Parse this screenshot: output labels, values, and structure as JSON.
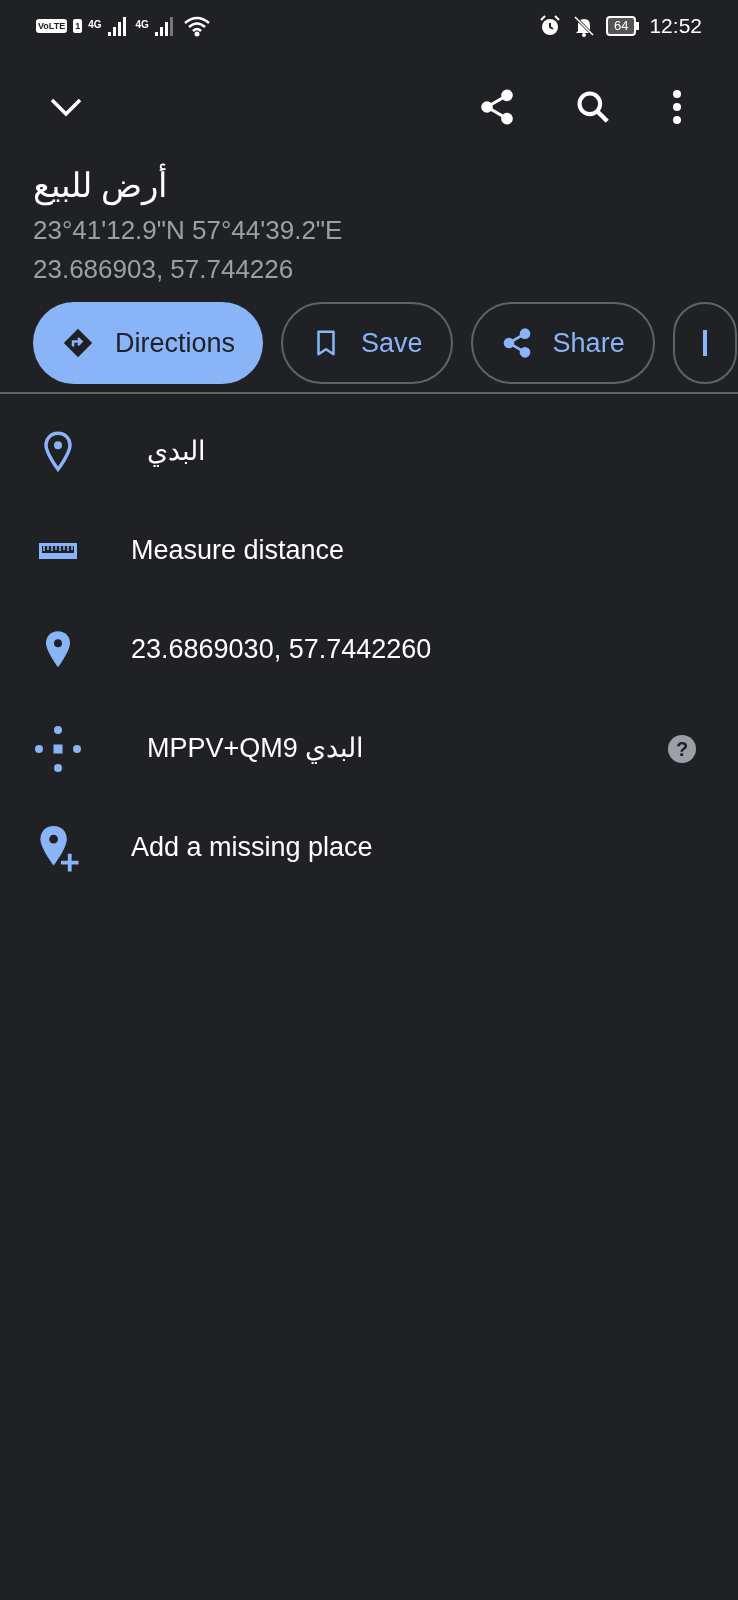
{
  "status_bar": {
    "volte": "VoLTE",
    "sim": "1",
    "network_1": "4G",
    "network_2": "4G",
    "battery": "64",
    "time": "12:52"
  },
  "title": "أرض للبيع",
  "coordinates_dms": "23°41'12.9\"N 57°44'39.2\"E",
  "coordinates_decimal": "23.686903, 57.744226",
  "actions": [
    {
      "kind": "directions",
      "label": "Directions"
    },
    {
      "kind": "save",
      "label": "Save"
    },
    {
      "kind": "share",
      "label": "Share"
    },
    {
      "kind": "partial"
    }
  ],
  "rows": [
    {
      "kind": "place",
      "text": "البدي"
    },
    {
      "kind": "measure",
      "text": "Measure distance"
    },
    {
      "kind": "coords",
      "text": "23.6869030, 57.7442260"
    },
    {
      "kind": "pluscode",
      "text": "MPPV+QM9 البدي",
      "help": "?"
    },
    {
      "kind": "add",
      "text": "Add a missing place"
    }
  ]
}
